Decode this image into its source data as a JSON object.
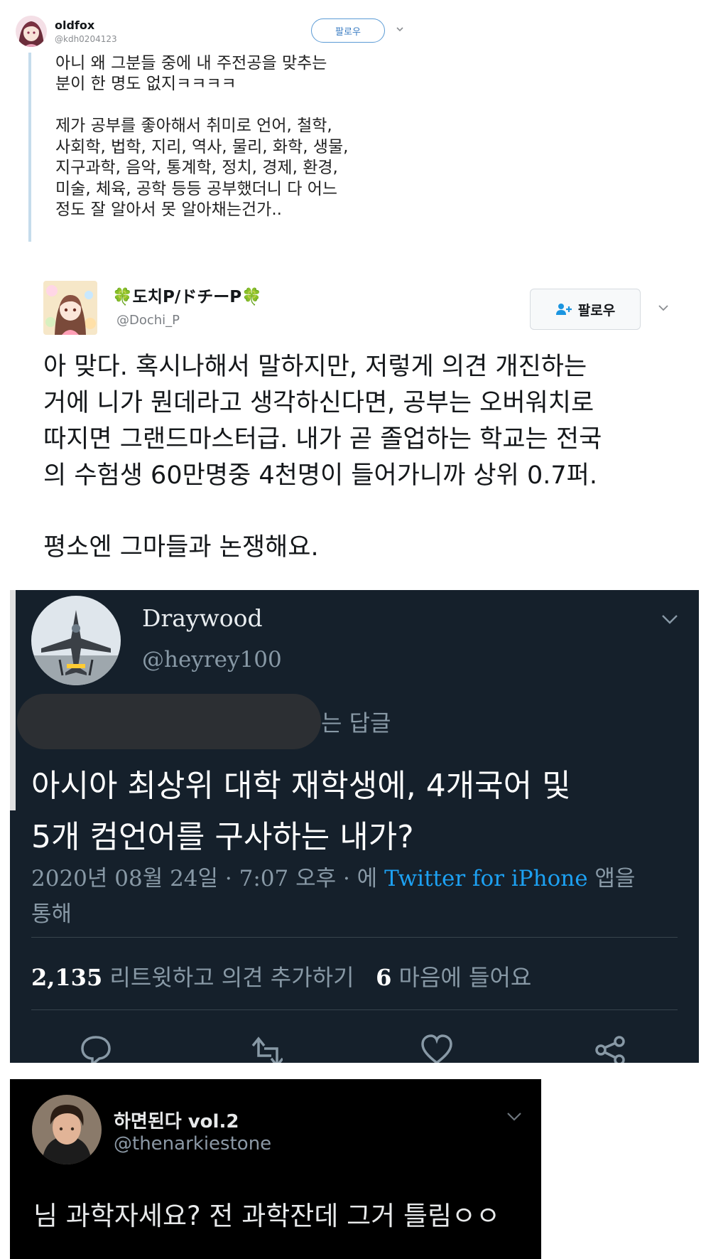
{
  "tweet1": {
    "author_name": "oldfox",
    "handle": "@kdh0204123",
    "follow_label": "팔로우",
    "lines": [
      "아니 왜 그분들 중에 내 주전공을 맞추는",
      "분이 한 명도 없지ㅋㅋㅋㅋ",
      "제가 공부를 좋아해서 취미로 언어, 철학,",
      "사회학, 법학, 지리, 역사, 물리, 화학, 생물,",
      "지구과학, 음악, 통계학, 정치, 경제, 환경,",
      "미술, 체육, 공학 등등 공부했더니 다 어느",
      "정도 잘 알아서 못 알아채는건가.."
    ],
    "accent_color": "#c5dcec"
  },
  "tweet2": {
    "author_name": "🍀도치P/ドチーP🍀",
    "handle": "@Dochi_P",
    "follow_label": "팔로우",
    "lines": [
      "아 맞다. 혹시나해서 말하지만, 저렇게 의견 개진하는",
      "거에 니가 뭔데라고 생각하신다면, 공부는 오버워치로",
      "따지면 그랜드마스터급. 내가 곧 졸업하는 학교는 전국",
      "의 수험생 60만명중 4천명이 들어가니까 상위 0.7퍼.",
      "평소엔 그마들과 논쟁해요."
    ]
  },
  "tweet3": {
    "author_name": "Draywood",
    "handle": "@heyrey100",
    "reply_suffix": "는 답글",
    "lines": [
      "아시아 최상위 대학 재학생에, 4개국어 및",
      "5개 컴언어를 구사하는 내가?"
    ],
    "meta_prefix": "2020년 08월 24일 · 7:07 오후 · 에 ",
    "meta_link": "Twitter for iPhone",
    "meta_suffix": " 앱을",
    "meta_line2": "통해",
    "retweet_count": "2,135",
    "retweet_label": " 리트윗하고 의견 추가하기",
    "like_count": "6",
    "like_label": " 마음에 들어요",
    "background": "#15202b",
    "link_color": "#1da1f2"
  },
  "tweet4": {
    "author_name": "하면된다 vol.2",
    "handle": "@thenarkiestone",
    "text": "님 과학자세요? 전 과학잔데 그거 틀림ㅇㅇ",
    "background": "#000000"
  }
}
